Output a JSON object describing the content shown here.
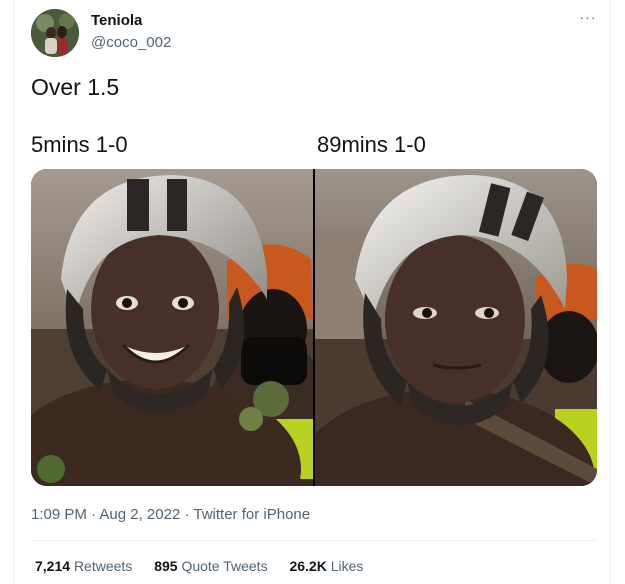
{
  "tweet": {
    "author_name": "Teniola",
    "author_handle": "@coco_002",
    "text": "Over 1.5",
    "more_menu_label": "···"
  },
  "media": {
    "left_caption": "5mins 1-0",
    "right_caption": "89mins 1-0"
  },
  "meta": {
    "time": "1:09 PM",
    "separator": "·",
    "date": "Aug 2, 2022",
    "source": "Twitter for iPhone"
  },
  "stats": {
    "retweets_count": "7,214",
    "retweets_label": "Retweets",
    "quotes_count": "895",
    "quotes_label": "Quote Tweets",
    "likes_count": "26.2K",
    "likes_label": "Likes"
  },
  "colors": {
    "text_primary": "#0f1419",
    "text_secondary": "#536471",
    "divider": "#eff3f4"
  }
}
